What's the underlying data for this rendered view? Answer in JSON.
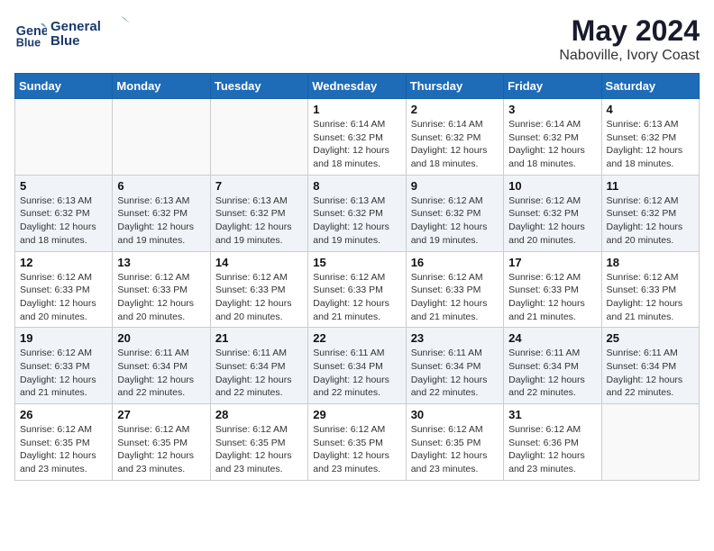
{
  "header": {
    "logo_line1": "General",
    "logo_line2": "Blue",
    "month_year": "May 2024",
    "location": "Naboville, Ivory Coast"
  },
  "weekdays": [
    "Sunday",
    "Monday",
    "Tuesday",
    "Wednesday",
    "Thursday",
    "Friday",
    "Saturday"
  ],
  "weeks": [
    [
      {
        "day": "",
        "info": ""
      },
      {
        "day": "",
        "info": ""
      },
      {
        "day": "",
        "info": ""
      },
      {
        "day": "1",
        "info": "Sunrise: 6:14 AM\nSunset: 6:32 PM\nDaylight: 12 hours\nand 18 minutes."
      },
      {
        "day": "2",
        "info": "Sunrise: 6:14 AM\nSunset: 6:32 PM\nDaylight: 12 hours\nand 18 minutes."
      },
      {
        "day": "3",
        "info": "Sunrise: 6:14 AM\nSunset: 6:32 PM\nDaylight: 12 hours\nand 18 minutes."
      },
      {
        "day": "4",
        "info": "Sunrise: 6:13 AM\nSunset: 6:32 PM\nDaylight: 12 hours\nand 18 minutes."
      }
    ],
    [
      {
        "day": "5",
        "info": "Sunrise: 6:13 AM\nSunset: 6:32 PM\nDaylight: 12 hours\nand 18 minutes."
      },
      {
        "day": "6",
        "info": "Sunrise: 6:13 AM\nSunset: 6:32 PM\nDaylight: 12 hours\nand 19 minutes."
      },
      {
        "day": "7",
        "info": "Sunrise: 6:13 AM\nSunset: 6:32 PM\nDaylight: 12 hours\nand 19 minutes."
      },
      {
        "day": "8",
        "info": "Sunrise: 6:13 AM\nSunset: 6:32 PM\nDaylight: 12 hours\nand 19 minutes."
      },
      {
        "day": "9",
        "info": "Sunrise: 6:12 AM\nSunset: 6:32 PM\nDaylight: 12 hours\nand 19 minutes."
      },
      {
        "day": "10",
        "info": "Sunrise: 6:12 AM\nSunset: 6:32 PM\nDaylight: 12 hours\nand 20 minutes."
      },
      {
        "day": "11",
        "info": "Sunrise: 6:12 AM\nSunset: 6:32 PM\nDaylight: 12 hours\nand 20 minutes."
      }
    ],
    [
      {
        "day": "12",
        "info": "Sunrise: 6:12 AM\nSunset: 6:33 PM\nDaylight: 12 hours\nand 20 minutes."
      },
      {
        "day": "13",
        "info": "Sunrise: 6:12 AM\nSunset: 6:33 PM\nDaylight: 12 hours\nand 20 minutes."
      },
      {
        "day": "14",
        "info": "Sunrise: 6:12 AM\nSunset: 6:33 PM\nDaylight: 12 hours\nand 20 minutes."
      },
      {
        "day": "15",
        "info": "Sunrise: 6:12 AM\nSunset: 6:33 PM\nDaylight: 12 hours\nand 21 minutes."
      },
      {
        "day": "16",
        "info": "Sunrise: 6:12 AM\nSunset: 6:33 PM\nDaylight: 12 hours\nand 21 minutes."
      },
      {
        "day": "17",
        "info": "Sunrise: 6:12 AM\nSunset: 6:33 PM\nDaylight: 12 hours\nand 21 minutes."
      },
      {
        "day": "18",
        "info": "Sunrise: 6:12 AM\nSunset: 6:33 PM\nDaylight: 12 hours\nand 21 minutes."
      }
    ],
    [
      {
        "day": "19",
        "info": "Sunrise: 6:12 AM\nSunset: 6:33 PM\nDaylight: 12 hours\nand 21 minutes."
      },
      {
        "day": "20",
        "info": "Sunrise: 6:11 AM\nSunset: 6:34 PM\nDaylight: 12 hours\nand 22 minutes."
      },
      {
        "day": "21",
        "info": "Sunrise: 6:11 AM\nSunset: 6:34 PM\nDaylight: 12 hours\nand 22 minutes."
      },
      {
        "day": "22",
        "info": "Sunrise: 6:11 AM\nSunset: 6:34 PM\nDaylight: 12 hours\nand 22 minutes."
      },
      {
        "day": "23",
        "info": "Sunrise: 6:11 AM\nSunset: 6:34 PM\nDaylight: 12 hours\nand 22 minutes."
      },
      {
        "day": "24",
        "info": "Sunrise: 6:11 AM\nSunset: 6:34 PM\nDaylight: 12 hours\nand 22 minutes."
      },
      {
        "day": "25",
        "info": "Sunrise: 6:11 AM\nSunset: 6:34 PM\nDaylight: 12 hours\nand 22 minutes."
      }
    ],
    [
      {
        "day": "26",
        "info": "Sunrise: 6:12 AM\nSunset: 6:35 PM\nDaylight: 12 hours\nand 23 minutes."
      },
      {
        "day": "27",
        "info": "Sunrise: 6:12 AM\nSunset: 6:35 PM\nDaylight: 12 hours\nand 23 minutes."
      },
      {
        "day": "28",
        "info": "Sunrise: 6:12 AM\nSunset: 6:35 PM\nDaylight: 12 hours\nand 23 minutes."
      },
      {
        "day": "29",
        "info": "Sunrise: 6:12 AM\nSunset: 6:35 PM\nDaylight: 12 hours\nand 23 minutes."
      },
      {
        "day": "30",
        "info": "Sunrise: 6:12 AM\nSunset: 6:35 PM\nDaylight: 12 hours\nand 23 minutes."
      },
      {
        "day": "31",
        "info": "Sunrise: 6:12 AM\nSunset: 6:36 PM\nDaylight: 12 hours\nand 23 minutes."
      },
      {
        "day": "",
        "info": ""
      }
    ]
  ]
}
